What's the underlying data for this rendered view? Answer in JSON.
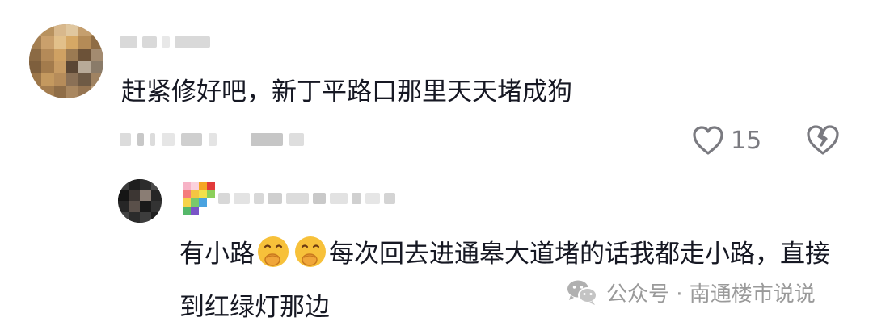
{
  "comment": {
    "text": "赶紧修好吧，新丁平路口那里天天堵成狗",
    "like_count": "15"
  },
  "reply": {
    "text_part1": "有小路",
    "text_part2": "每次回去进通皋大道堵的话我都走小路，直接到红绿灯那边",
    "emoji": [
      "hand-over-mouth-emoji",
      "hand-over-mouth-emoji"
    ]
  },
  "watermark": {
    "text": "公众号 · 南通楼市说说",
    "icon": "wechat-icon"
  },
  "icons": {
    "like": "heart-outline-icon",
    "dislike": "broken-heart-icon"
  },
  "colors": {
    "text": "#161823",
    "muted": "#7a7a80",
    "watermark": "#9a9a9a",
    "emoji": "#f7c13a"
  }
}
